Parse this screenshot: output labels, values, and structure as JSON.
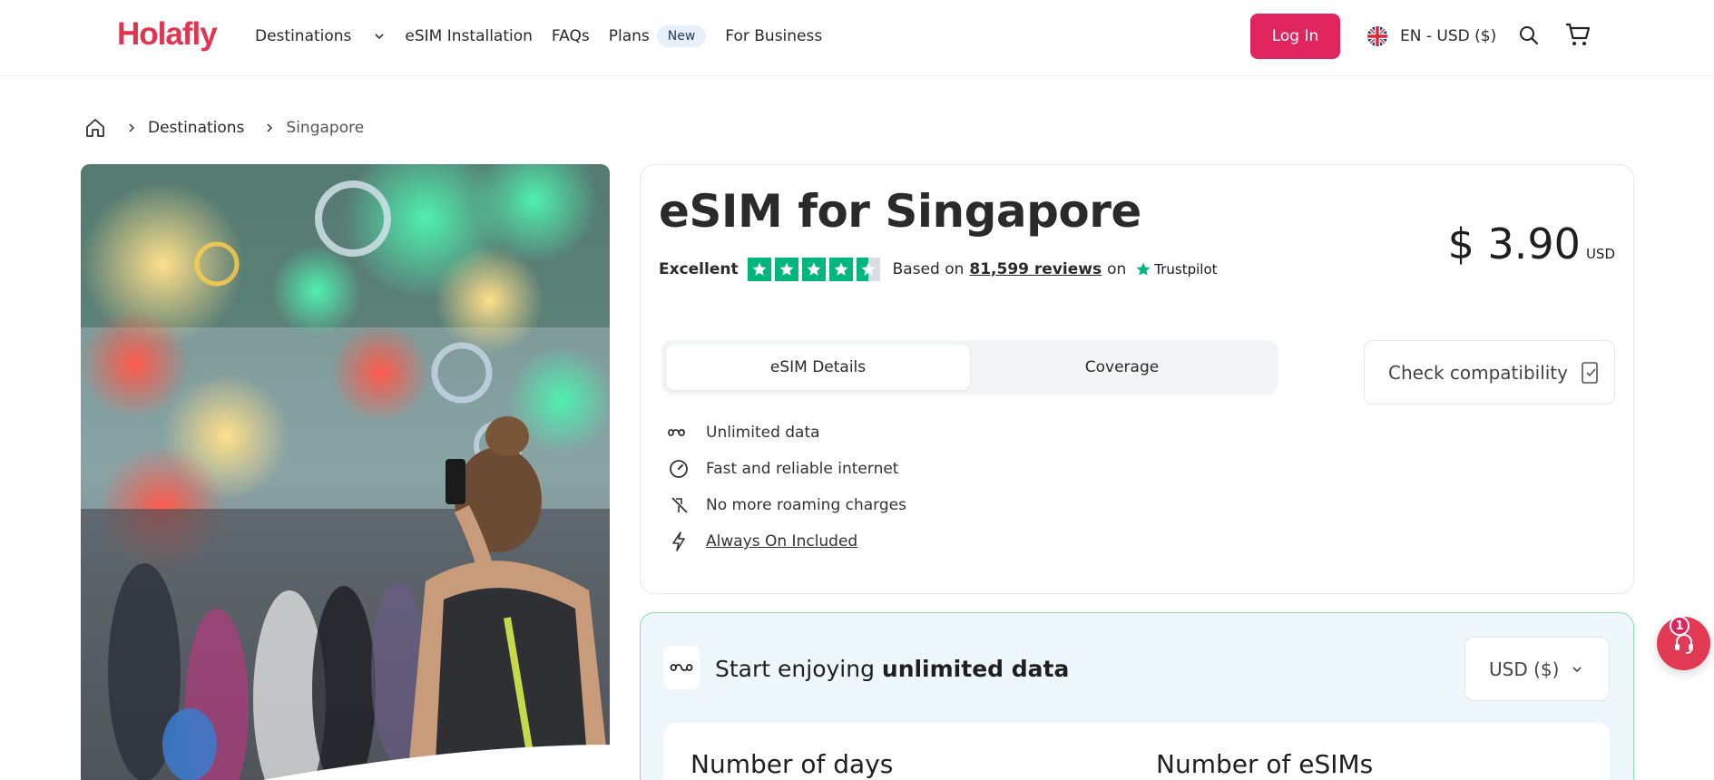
{
  "brand": {
    "logo_text": "Holafly",
    "accent_color": "#e2334f"
  },
  "nav": {
    "destinations": "Destinations",
    "esim_installation": "eSIM Installation",
    "faqs": "FAQs",
    "plans": "Plans",
    "plans_badge": "New",
    "for_business": "For Business"
  },
  "header": {
    "login_label": "Log In",
    "language_label": "EN - USD ($)",
    "search_icon": "search-icon",
    "cart_icon": "cart-icon"
  },
  "breadcrumb": {
    "home_icon": "home-icon",
    "items": [
      "Destinations",
      "Singapore"
    ]
  },
  "product": {
    "title": "eSIM for Singapore",
    "rating_word": "Excellent",
    "stars": 4.5,
    "based_on": "Based on",
    "reviews_link": "81,599 reviews",
    "on_word": "on",
    "trustpilot": "Trustpilot",
    "price_amount": "$ 3.90",
    "price_currency": "USD",
    "tabs": [
      "eSIM Details",
      "Coverage"
    ],
    "active_tab": "eSIM Details",
    "check_compatibility": "Check compatibility",
    "features": [
      {
        "icon": "infinity-icon",
        "label": "Unlimited data"
      },
      {
        "icon": "speedometer-icon",
        "label": "Fast and reliable internet"
      },
      {
        "icon": "no-roaming-icon",
        "label": "No more roaming charges"
      },
      {
        "icon": "lightning-icon",
        "label": "Always On Included"
      }
    ]
  },
  "plan": {
    "title_prefix": "Start enjoying ",
    "title_bold": "unlimited data",
    "currency_select": "USD ($)",
    "number_of_days": "Number of days",
    "number_of_esims": "Number of eSIMs"
  },
  "chat": {
    "badge_count": "1"
  }
}
